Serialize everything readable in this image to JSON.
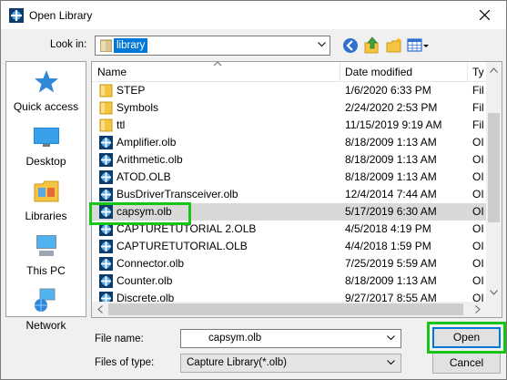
{
  "window": {
    "title": "Open Library",
    "close_label": "✕"
  },
  "lookin": {
    "label": "Look in:",
    "value": "library"
  },
  "places": [
    {
      "label": "Quick access",
      "icon": "star-icon"
    },
    {
      "label": "Desktop",
      "icon": "desktop-icon"
    },
    {
      "label": "Libraries",
      "icon": "libraries-icon"
    },
    {
      "label": "This PC",
      "icon": "computer-icon"
    },
    {
      "label": "Network",
      "icon": "network-icon"
    }
  ],
  "columns": {
    "name": "Name",
    "date": "Date modified",
    "type": "Ty"
  },
  "files": [
    {
      "name": "STEP",
      "date": "1/6/2020 6:33 PM",
      "type": "Fil",
      "kind": "folder"
    },
    {
      "name": "Symbols",
      "date": "2/24/2020 2:53 PM",
      "type": "Fil",
      "kind": "folder"
    },
    {
      "name": "ttl",
      "date": "11/15/2019 9:19 AM",
      "type": "Fil",
      "kind": "folder"
    },
    {
      "name": "Amplifier.olb",
      "date": "8/18/2009 1:13 AM",
      "type": "OI",
      "kind": "olb"
    },
    {
      "name": "Arithmetic.olb",
      "date": "8/18/2009 1:13 AM",
      "type": "OI",
      "kind": "olb"
    },
    {
      "name": "ATOD.OLB",
      "date": "8/18/2009 1:13 AM",
      "type": "OI",
      "kind": "olb"
    },
    {
      "name": "BusDriverTransceiver.olb",
      "date": "12/4/2014 7:44 AM",
      "type": "OI",
      "kind": "olb"
    },
    {
      "name": "capsym.olb",
      "date": "5/17/2019 6:30 AM",
      "type": "OI",
      "kind": "olb"
    },
    {
      "name": "CAPTURETUTORIAL 2.OLB",
      "date": "4/5/2018 4:19 PM",
      "type": "OI",
      "kind": "olb"
    },
    {
      "name": "CAPTURETUTORIAL.OLB",
      "date": "4/4/2018 1:59 PM",
      "type": "OI",
      "kind": "olb"
    },
    {
      "name": "Connector.olb",
      "date": "7/25/2019 5:59 AM",
      "type": "OI",
      "kind": "olb"
    },
    {
      "name": "Counter.olb",
      "date": "8/18/2009 1:13 AM",
      "type": "OI",
      "kind": "olb"
    },
    {
      "name": "Discrete.olb",
      "date": "9/27/2017 8:55 AM",
      "type": "OI",
      "kind": "olb"
    }
  ],
  "selected_file": "capsym.olb",
  "filename": {
    "label": "File name:",
    "value": "capsym.olb"
  },
  "filetype": {
    "label": "Files of type:",
    "value": "Capture Library(*.olb)"
  },
  "buttons": {
    "open": "Open",
    "cancel": "Cancel"
  },
  "colors": {
    "highlight": "#19c419",
    "selection": "#0078d7",
    "folder": "#f5c542"
  }
}
